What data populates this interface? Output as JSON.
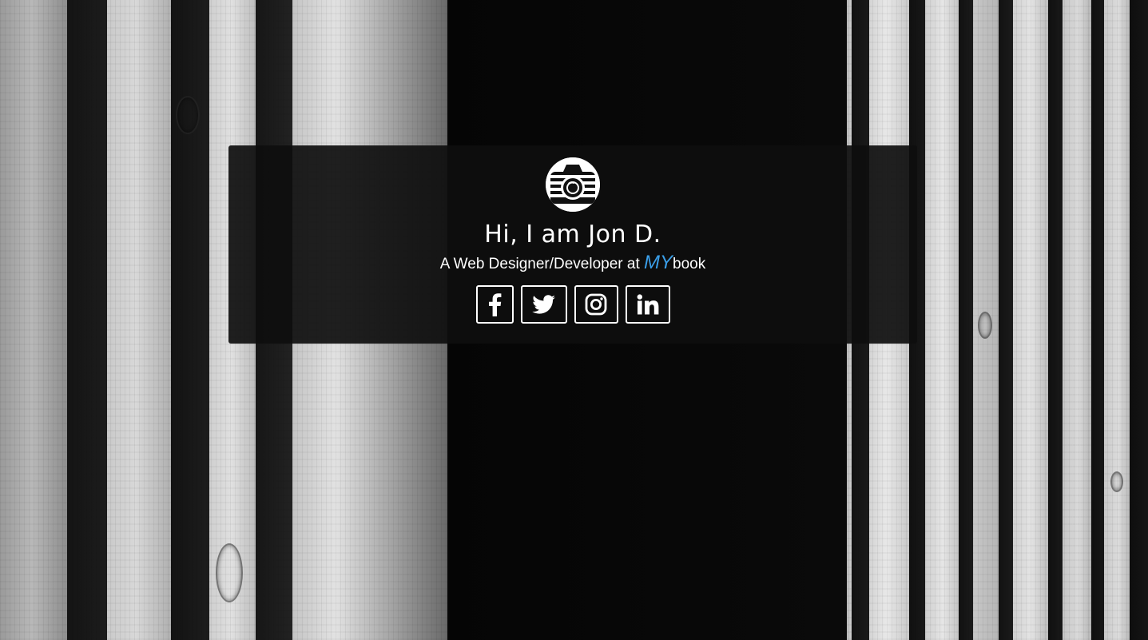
{
  "profile": {
    "greeting": "Hi, I am Jon D.",
    "subtitle_prefix": "A Web Designer/Developer at ",
    "brand_my": "MY",
    "brand_book": "book"
  },
  "socials": [
    {
      "icon": "facebook-icon"
    },
    {
      "icon": "twitter-icon"
    },
    {
      "icon": "instagram-icon"
    },
    {
      "icon": "linkedin-icon"
    }
  ],
  "colors": {
    "brand_accent": "#3a9ee8",
    "card_background": "#0e0e0e",
    "text": "#ffffff"
  },
  "logo": {
    "icon": "camera-icon"
  }
}
